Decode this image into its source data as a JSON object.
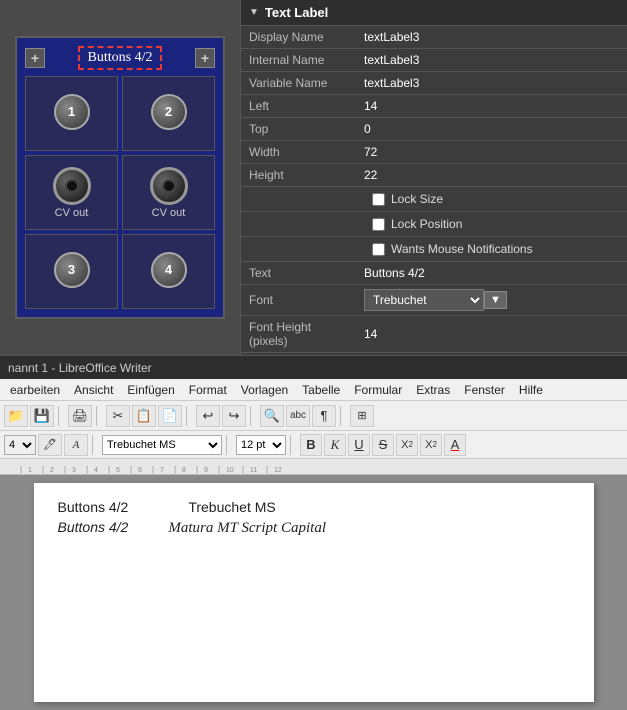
{
  "top_panel": {
    "widget": {
      "title": "Buttons 4/2",
      "buttons": [
        "1",
        "2",
        "3",
        "4"
      ],
      "cv_labels": [
        "CV out",
        "CV out"
      ]
    },
    "properties": {
      "header_triangle": "▼",
      "header_title": "Text Label",
      "rows": [
        {
          "label": "Display Name",
          "value": "textLabel3"
        },
        {
          "label": "Internal Name",
          "value": "textLabel3"
        },
        {
          "label": "Variable Name",
          "value": "textLabel3"
        },
        {
          "label": "Left",
          "value": "14"
        },
        {
          "label": "Top",
          "value": "0"
        },
        {
          "label": "Width",
          "value": "72"
        },
        {
          "label": "Height",
          "value": "22"
        }
      ],
      "checkboxes": [
        {
          "label": "Lock Size",
          "checked": false
        },
        {
          "label": "Lock Position",
          "checked": false
        },
        {
          "label": "Wants Mouse Notifications",
          "checked": false
        }
      ],
      "text_row": {
        "label": "Text",
        "value": "Buttons 4/2"
      },
      "font_row": {
        "label": "Font",
        "value": "Trebuchet"
      },
      "font_height_row": {
        "label": "Font Height (pixels)",
        "value": "14"
      }
    }
  },
  "title_bar": {
    "text": "nannt 1 - LibreOffice Writer"
  },
  "menu_bar": {
    "items": [
      "earbeiten",
      "Ansicht",
      "Einfügen",
      "Format",
      "Vorlagen",
      "Tabelle",
      "Formular",
      "Extras",
      "Fenster",
      "Hilfe"
    ]
  },
  "toolbar": {
    "buttons": [
      "📁",
      "💾",
      "|",
      "🖨",
      "|",
      "✂",
      "📋",
      "📄",
      "|",
      "↩",
      "↪",
      "|",
      "🔍",
      "abc",
      "¶",
      "|",
      "⊞",
      "|"
    ]
  },
  "toolbar2": {
    "style_select": "4",
    "icon1": "🖊",
    "icon2": "A",
    "font_name": "Trebuchet MS",
    "font_size": "12 pt",
    "bold_label": "B",
    "italic_label": "K",
    "underline_label": "U",
    "strike_label": "S",
    "super_label": "X²",
    "sub_label": "X₂",
    "color_label": "A"
  },
  "document": {
    "line1_left": "Buttons 4/2",
    "line1_right": "Trebuchet MS",
    "line2_left": "Buttons 4/2",
    "line2_right": "Matura MT Script Capital"
  }
}
